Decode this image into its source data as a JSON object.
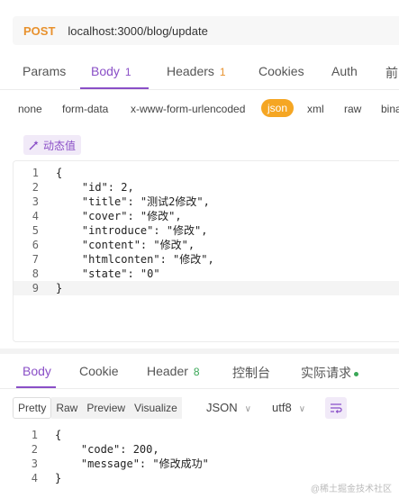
{
  "request": {
    "method": "POST",
    "url": "localhost:3000/blog/update"
  },
  "request_tabs": [
    {
      "label": "Params",
      "count": ""
    },
    {
      "label": "Body",
      "count": "1"
    },
    {
      "label": "Headers",
      "count": "1"
    },
    {
      "label": "Cookies",
      "count": ""
    },
    {
      "label": "Auth",
      "count": ""
    },
    {
      "label": "前",
      "count": ""
    }
  ],
  "body_types": [
    "none",
    "form-data",
    "x-www-form-urlencoded",
    "json",
    "xml",
    "raw",
    "bina"
  ],
  "dynamic_button": "动态值",
  "request_body_lines": [
    {
      "n": "1",
      "text": "{"
    },
    {
      "n": "2",
      "text": "    \"id\": 2,"
    },
    {
      "n": "3",
      "text": "    \"title\": \"测试2修改\","
    },
    {
      "n": "4",
      "text": "    \"cover\": \"修改\","
    },
    {
      "n": "5",
      "text": "    \"introduce\": \"修改\","
    },
    {
      "n": "6",
      "text": "    \"content\": \"修改\","
    },
    {
      "n": "7",
      "text": "    \"htmlconten\": \"修改\","
    },
    {
      "n": "8",
      "text": "    \"state\": \"0\""
    },
    {
      "n": "9",
      "text": "}"
    }
  ],
  "response_tabs": [
    {
      "label": "Body",
      "count": ""
    },
    {
      "label": "Cookie",
      "count": ""
    },
    {
      "label": "Header",
      "count": "8"
    },
    {
      "label": "控制台",
      "count": ""
    },
    {
      "label": "实际请求",
      "count": ""
    }
  ],
  "view_modes": [
    "Pretty",
    "Raw",
    "Preview",
    "Visualize"
  ],
  "format_select": "JSON",
  "encoding_select": "utf8",
  "response_body_lines": [
    {
      "n": "1",
      "text": "{"
    },
    {
      "n": "2",
      "text": "    \"code\": 200,"
    },
    {
      "n": "3",
      "text": "    \"message\": \"修改成功\""
    },
    {
      "n": "4",
      "text": "}"
    }
  ],
  "watermark": "@稀土掘金技术社区",
  "colors": {
    "accent": "#8a4fc7",
    "method": "#e8912d",
    "json_pill": "#f5a623",
    "status_dot": "#3aa757"
  }
}
